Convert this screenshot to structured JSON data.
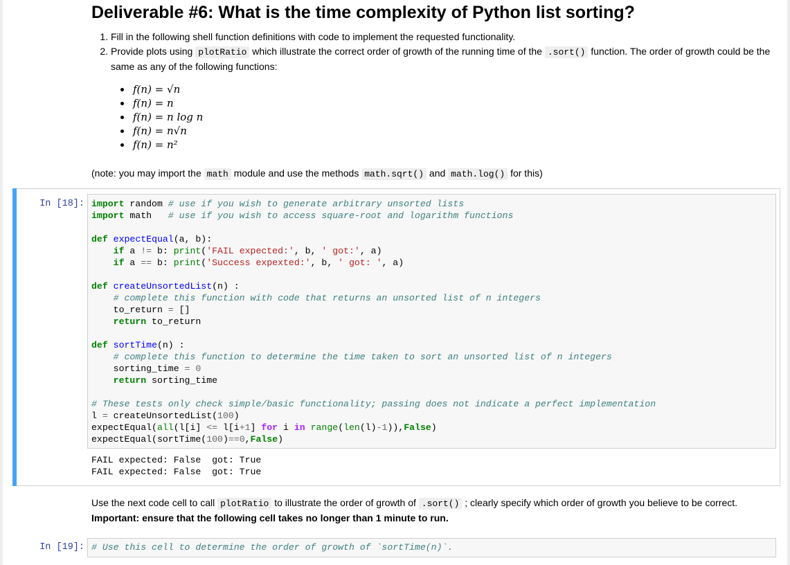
{
  "heading": "Deliverable #6: What is the time complexity of Python list sorting?",
  "steps": {
    "s1": "Fill in the following shell function definitions with code to implement the requested functionality.",
    "s2_a": "Provide plots using ",
    "s2_code1": "plotRatio",
    "s2_b": " which illustrate the correct order of growth of the running time of the ",
    "s2_code2": ".sort()",
    "s2_c": " function. The order of growth could be the same as any of the following functions:"
  },
  "functions": [
    "f(n) = √n",
    "f(n) = n",
    "f(n) = n log n",
    "f(n) = n√n",
    "f(n) = n²"
  ],
  "note": {
    "a": "(note: you may import the ",
    "code1": "math",
    "b": " module and use the methods ",
    "code2": "math.sqrt()",
    "c": " and ",
    "code3": "math.log()",
    "d": " for this)"
  },
  "cell1": {
    "prompt": "In [18]:",
    "output": "FAIL expected: False  got: True\nFAIL expected: False  got: True"
  },
  "next": {
    "a": "Use the next code cell to call ",
    "code1": "plotRatio",
    "b": " to illustrate the order of growth of ",
    "code2": ".sort()",
    "c": " ; clearly specify which order of growth you believe to be correct.",
    "important": "Important: ensure that the following cell takes no longer than 1 minute to run."
  },
  "cell2": {
    "prompt": "In [19]:",
    "code": "# Use this cell to determine the order of growth of `sortTime(n)`."
  }
}
